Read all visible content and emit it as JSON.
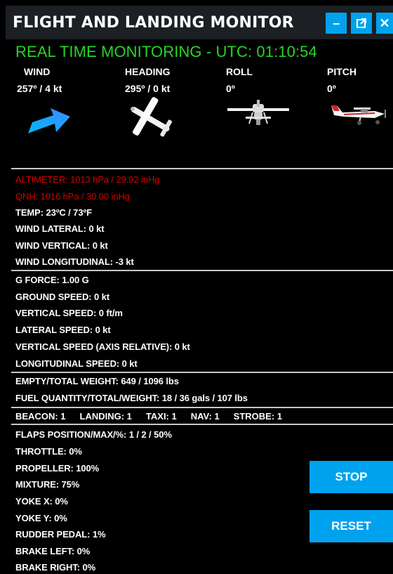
{
  "window": {
    "title": "FLIGHT AND LANDING MONITOR",
    "buttons": {
      "minimize": "–",
      "popout": "⧉",
      "close": "✕"
    }
  },
  "live": "REAL TIME MONITORING - UTC: 01:10:54",
  "indicators": [
    {
      "label": "WIND",
      "value": "257º / 4 kt",
      "icon": "wind-arrow-icon"
    },
    {
      "label": "HEADING",
      "value": "295º / 0 kt",
      "icon": "plane-top-view-icon"
    },
    {
      "label": "ROLL",
      "value": "0º",
      "icon": "plane-front-view-icon"
    },
    {
      "label": "PITCH",
      "value": "0º",
      "icon": "plane-side-view-icon"
    }
  ],
  "atmosphere": [
    "ALTIMETER: 1013 hPa / 29.92 inHg",
    "QNH: 1016 hPa / 30.00 inHg",
    "TEMP: 23ºC / 73ºF",
    "WIND LATERAL: 0 kt",
    "WIND VERTICAL: 0 kt",
    "WIND LONGITUDINAL: -3 kt"
  ],
  "speeds": [
    "G FORCE: 1.00 G",
    "GROUND SPEED: 0 kt",
    "VERTICAL SPEED: 0 ft/m",
    "LATERAL SPEED: 0 kt",
    "VERTICAL SPEED (AXIS RELATIVE): 0 kt",
    "LONGITUDINAL SPEED: 0 kt"
  ],
  "weights": [
    "EMPTY/TOTAL WEIGHT: 649 / 1096 lbs",
    "FUEL QUANTITY/TOTAL/WEIGHT: 18 / 36 gals / 107 lbs"
  ],
  "lights": [
    "BEACON: 1",
    "LANDING: 1",
    "TAXI: 1",
    "NAV: 1",
    "STROBE: 1"
  ],
  "controls": [
    "FLAPS POSITION/MAX/%: 1 / 2 / 50%",
    "THROTTLE: 0%",
    "PROPELLER: 100%",
    "MIXTURE: 75%",
    "YOKE X: 0%",
    "YOKE Y: 0%",
    "RUDDER PEDAL: 1%",
    "BRAKE LEFT: 0%",
    "BRAKE RIGHT: 0%"
  ],
  "actions": {
    "stop": "STOP",
    "reset": "RESET"
  },
  "colors": {
    "accent": "#00a2ed",
    "live_green": "#27d427",
    "alert_red": "#d40000",
    "titlebar": "#1c1f24",
    "background": "#000000"
  }
}
